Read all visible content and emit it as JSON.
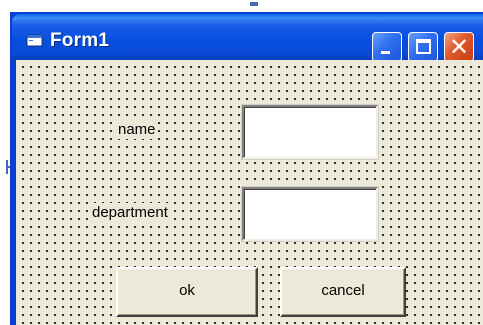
{
  "window": {
    "title": "Form1"
  },
  "form": {
    "name_label": "name",
    "name_value": "",
    "department_label": "department",
    "department_value": ""
  },
  "buttons": {
    "ok_label": "ok",
    "cancel_label": "cancel",
    "close_glyph": "✕"
  },
  "icons": {
    "window_icon": "form-window-icon",
    "minimize": "minimize-icon",
    "maximize": "maximize-icon",
    "close": "close-icon"
  },
  "colors": {
    "titlebar": "#0a4ad6",
    "close_button": "#e3572c",
    "client_background": "#ece9d8"
  }
}
